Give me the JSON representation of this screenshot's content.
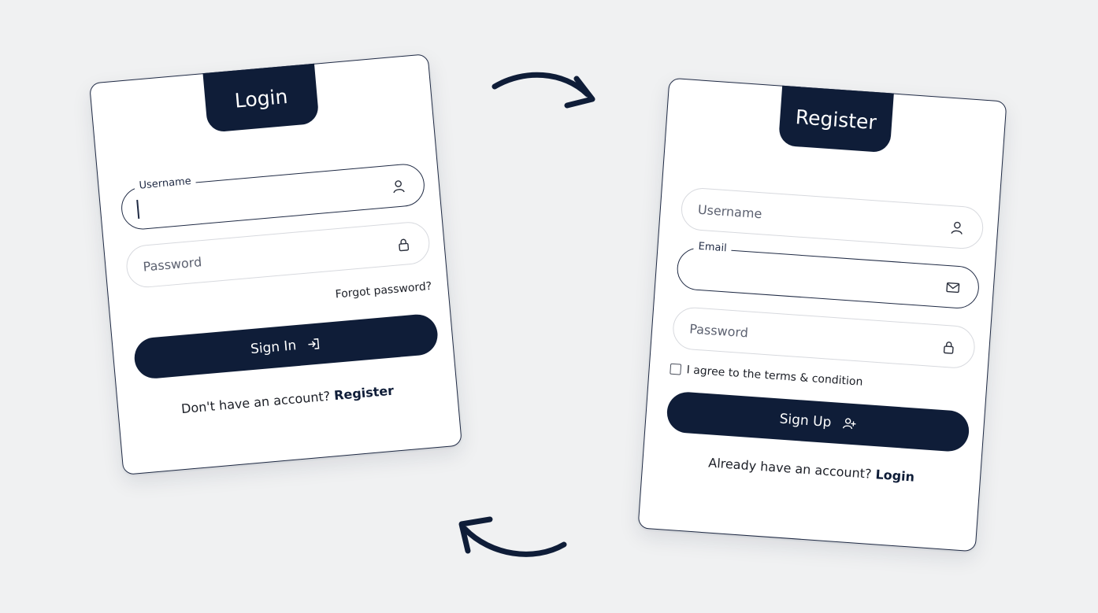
{
  "login": {
    "title": "Login",
    "username_label": "Username",
    "password_placeholder": "Password",
    "forgot": "Forgot password?",
    "signin": "Sign In",
    "footer_text": "Don't have an account?",
    "footer_link": "Register",
    "icons": [
      "user-icon",
      "lock-icon",
      "login-icon"
    ]
  },
  "register": {
    "title": "Register",
    "username_placeholder": "Username",
    "email_label": "Email",
    "password_placeholder": "Password",
    "terms": "I agree to the terms & condition",
    "signup": "Sign Up",
    "footer_text": "Already have an account?",
    "footer_link": "Login",
    "icons": [
      "user-icon",
      "mail-icon",
      "lock-icon",
      "add-user-icon"
    ]
  },
  "colors": {
    "navy": "#0f1d38",
    "background": "#f0f1f2",
    "card": "#ffffff"
  }
}
